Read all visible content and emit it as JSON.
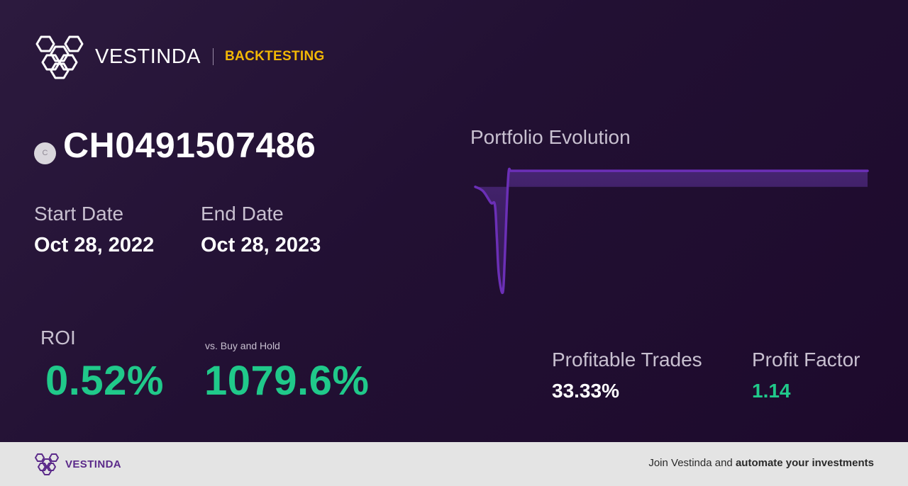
{
  "header": {
    "brand": "VESTINDA",
    "tag": "BACKTESTING"
  },
  "asset": {
    "coin_letter": "C",
    "symbol": "CH0491507486"
  },
  "dates": {
    "start_label": "Start Date",
    "start_value": "Oct 28, 2022",
    "end_label": "End Date",
    "end_value": "Oct 28, 2023"
  },
  "metrics": {
    "roi_label": "ROI",
    "roi_value": "0.52%",
    "vs_label": "vs. Buy and Hold",
    "vs_value": "1079.6%",
    "profitable_label": "Profitable Trades",
    "profitable_value": "33.33%",
    "factor_label": "Profit Factor",
    "factor_value": "1.14"
  },
  "chart": {
    "title": "Portfolio Evolution"
  },
  "chart_data": {
    "type": "line",
    "title": "Portfolio Evolution",
    "x": [
      0,
      0.02,
      0.04,
      0.05,
      0.055,
      0.06,
      0.07,
      0.075,
      0.08,
      0.085,
      0.09,
      0.1,
      0.2,
      0.4,
      0.6,
      0.8,
      1.0
    ],
    "series": [
      {
        "values": [
          0,
          -6,
          -22,
          -25,
          -70,
          -120,
          -145,
          -100,
          -30,
          20,
          22,
          22,
          22,
          22,
          22,
          22,
          22
        ]
      }
    ],
    "ylim": [
      -150,
      25
    ],
    "grid": false,
    "line_color": "#6b2fb6"
  },
  "footer": {
    "brand": "VESTINDA",
    "cta_prefix": "Join Vestinda and ",
    "cta_bold": "automate your investments"
  },
  "colors": {
    "accent_yellow": "#f2b705",
    "positive_green": "#20c98a",
    "line_purple": "#6b2fb6"
  }
}
